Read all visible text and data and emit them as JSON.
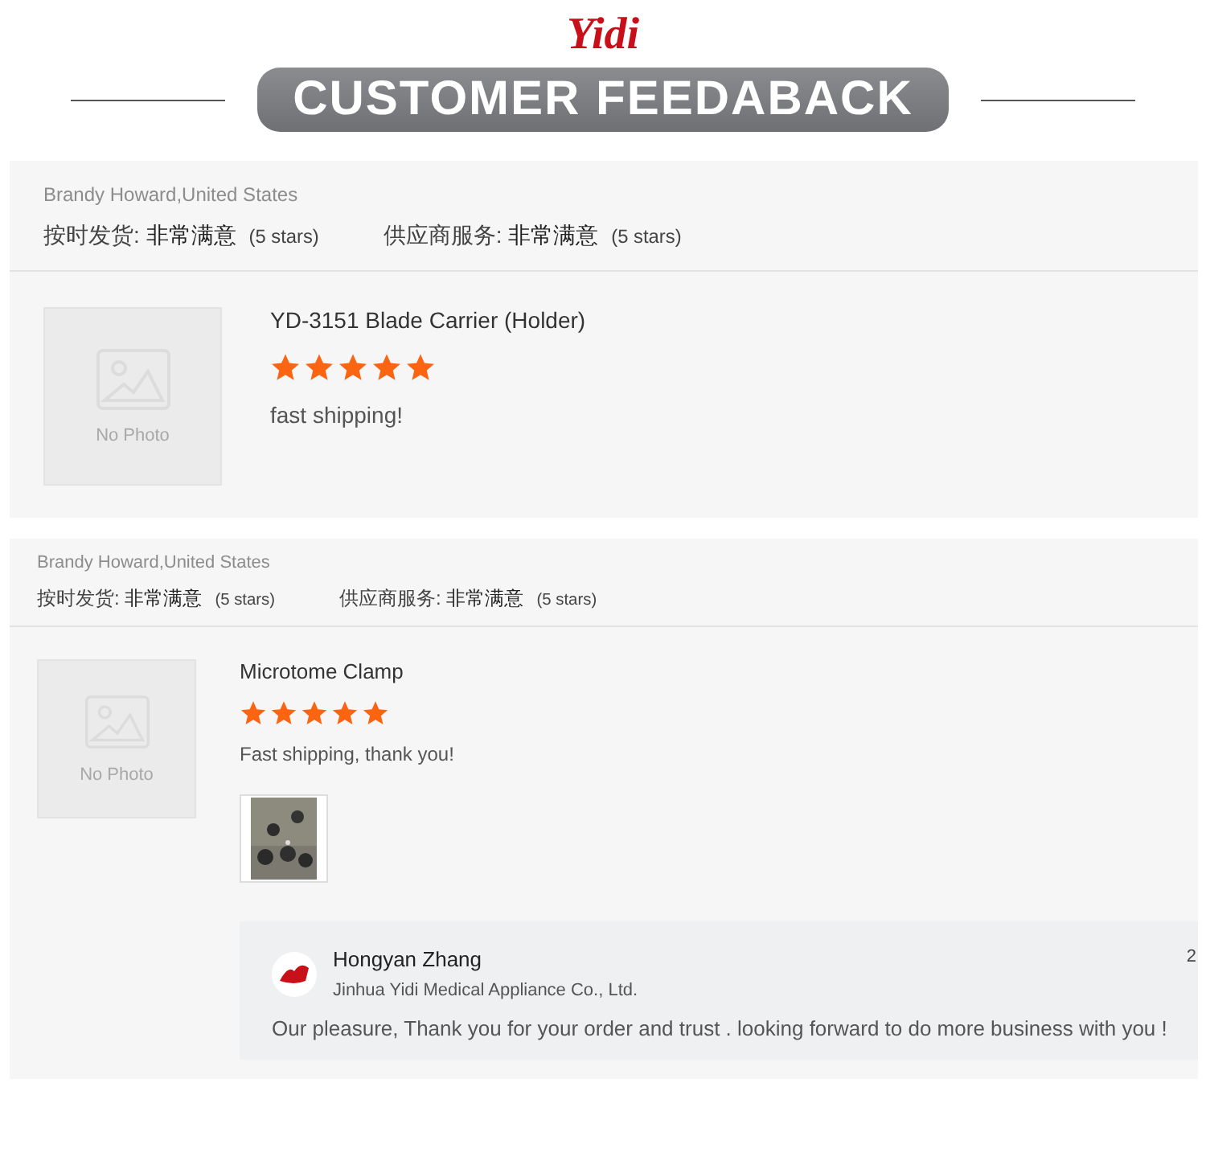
{
  "header": {
    "logo": "Yidi",
    "title": "CUSTOMER FEEDABACK"
  },
  "reviews": [
    {
      "compact": false,
      "buyer": "Brandy Howard,United States",
      "ratings": [
        {
          "label": "按时发货:",
          "value": "非常满意",
          "count": "(5 stars)"
        },
        {
          "label": "供应商服务:",
          "value": "非常满意",
          "count": "(5 stars)"
        }
      ],
      "placeholder": "No Photo",
      "product": "YD-3151 Blade Carrier (Holder)",
      "stars": 5,
      "comment": "fast shipping!"
    },
    {
      "compact": true,
      "buyer": "Brandy Howard,United States",
      "ratings": [
        {
          "label": "按时发货:",
          "value": "非常满意",
          "count": "(5 stars)"
        },
        {
          "label": "供应商服务:",
          "value": "非常满意",
          "count": "(5 stars)"
        }
      ],
      "placeholder": "No Photo",
      "product": "Microtome Clamp",
      "stars": 5,
      "comment": "Fast shipping, thank you!",
      "photos": [
        {
          "kind": "picture"
        }
      ],
      "reply": {
        "name": "Hongyan Zhang",
        "company": "Jinhua Yidi Medical Appliance Co., Ltd.",
        "message": "Our pleasure, Thank you for your order and trust . looking forward to do more business with you !",
        "date": "2"
      }
    }
  ]
}
